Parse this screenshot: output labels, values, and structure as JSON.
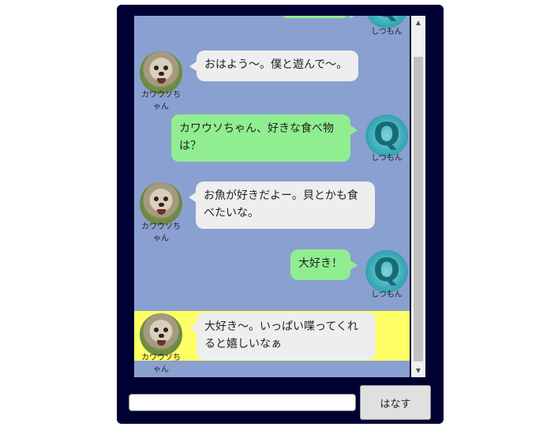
{
  "chat": {
    "partial_top": {
      "role": "user",
      "name": "しつもん"
    },
    "messages": [
      {
        "role": "bot",
        "name_line1": "カワウソち",
        "name_line2": "ゃん",
        "text_line1": "おはよう～。僕と遊んで～。",
        "text_line2": ""
      },
      {
        "role": "user",
        "name": "しつもん",
        "text_line1": "カワウソちゃん、好きな食べ物",
        "text_line2": "は？"
      },
      {
        "role": "bot",
        "name_line1": "カワウソち",
        "name_line2": "ゃん",
        "text_line1": "お魚が好きだよー。貝とかも食",
        "text_line2": "べたいな。"
      },
      {
        "role": "user",
        "name": "しつもん",
        "text_line1": "大好き！",
        "text_line2": ""
      },
      {
        "role": "bot",
        "name_line1": "カワウソち",
        "name_line2": "ゃん",
        "text_line1": "大好き～。いっぱい喋ってくれ",
        "text_line2": "ると嬉しいなぁ",
        "highlighted": true
      }
    ]
  },
  "composer": {
    "input_value": "",
    "send_label": "はなす"
  },
  "icons": {
    "bot_avatar": "otter-avatar-icon",
    "user_avatar": "q-question-icon",
    "scroll_up": "scroll-up-arrow-icon",
    "scroll_down": "scroll-down-arrow-icon"
  },
  "colors": {
    "frame": "#000033",
    "chat_bg": "#8aa0d0",
    "bot_bubble": "#eeeeee",
    "user_bubble": "#90ee90",
    "highlight": "#ffff66"
  }
}
